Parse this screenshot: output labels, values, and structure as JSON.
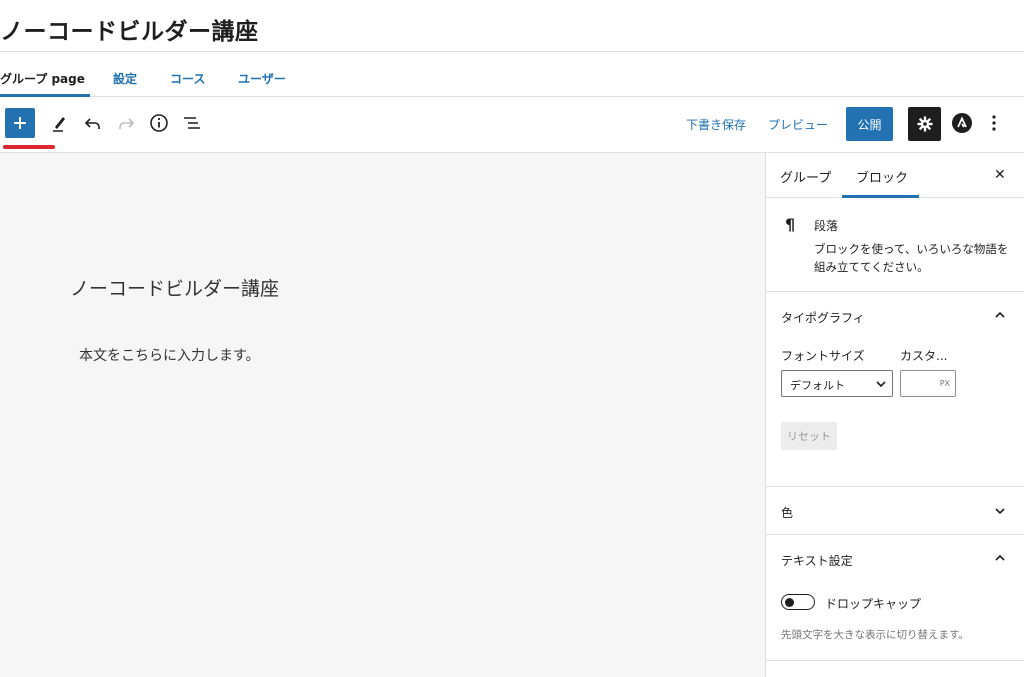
{
  "header": {
    "title": "ノーコードビルダー講座"
  },
  "tabs": [
    {
      "label": "グループ page"
    },
    {
      "label": "設定"
    },
    {
      "label": "コース"
    },
    {
      "label": "ユーザー"
    }
  ],
  "toolbar": {
    "save_draft": "下書き保存",
    "preview": "プレビュー",
    "publish": "公開"
  },
  "canvas": {
    "heading": "ノーコードビルダー講座",
    "paragraph": "本文をこちらに入力します。"
  },
  "sidebar": {
    "tabs": [
      {
        "label": "グループ"
      },
      {
        "label": "ブロック"
      }
    ],
    "close": "✕",
    "block": {
      "icon": "¶",
      "name": "段落",
      "description": "ブロックを使って、いろいろな物語を組み立ててください。"
    },
    "typography": {
      "title": "タイポグラフィ",
      "font_size_label": "フォントサイズ",
      "custom_label": "カスタ...",
      "font_size_value": "デフォルト",
      "unit": "PX",
      "reset": "リセット"
    },
    "color": {
      "title": "色"
    },
    "text_settings": {
      "title": "テキスト設定",
      "dropcap_label": "ドロップキャップ",
      "dropcap_help": "先頭文字を大きな表示に切り替えます。"
    }
  },
  "colors": {
    "accent": "#2271b1",
    "highlight": "#e0262e",
    "dark": "#1e1e1e"
  }
}
